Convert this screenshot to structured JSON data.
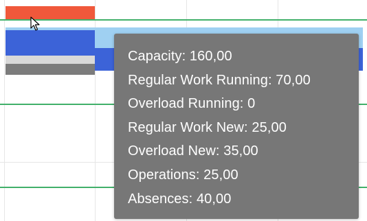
{
  "colors": {
    "capacity_bar": "#f0583b",
    "regular_running_bar": "#3c63d8",
    "regular_new_bar": "#9fd0f2",
    "separator_bar": "#d9d9d9",
    "absences_bar": "#7c7c7c",
    "green_line": "#41b06a",
    "tooltip_background": "#777777",
    "tooltip_text": "#ffffff"
  },
  "tooltip": {
    "lines": [
      "Capacity: 160,00",
      "Regular Work Running: 70,00",
      "Overload Running: 0",
      "Regular Work New: 25,00",
      "Overload New: 35,00",
      "Operations: 25,00",
      "Absences: 40,00"
    ]
  },
  "cursor": {
    "icon": "arrow-pointer-icon"
  }
}
